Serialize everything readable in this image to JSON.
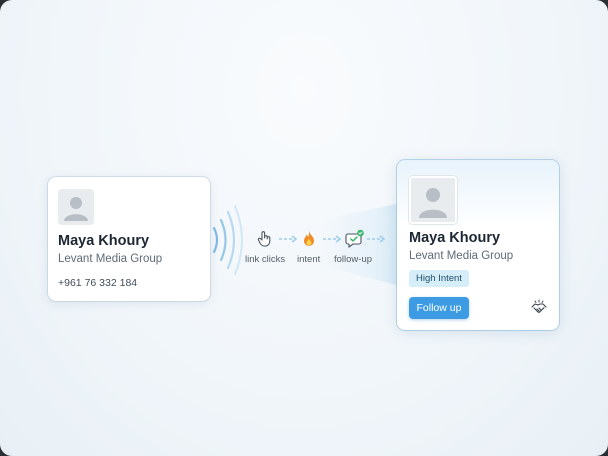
{
  "source_card": {
    "name": "Maya Khoury",
    "company": "Levant Media Group",
    "phone": "+961 76 332 184",
    "avatar_icon": "person-placeholder-icon",
    "signal_icon": "nfc-waves-icon"
  },
  "flow": {
    "steps": [
      {
        "label": "link clicks",
        "icon": "hand-pointer-icon"
      },
      {
        "label": "intent",
        "icon": "flame-icon"
      },
      {
        "label": "follow-up",
        "icon": "chat-check-icon"
      }
    ]
  },
  "crm_card": {
    "name": "Maya Khoury",
    "company": "Levant Media Group",
    "badge": "High Intent",
    "button": "Follow up",
    "avatar_icon": "person-placeholder-icon",
    "extra_icon": "handshake-icon"
  },
  "colors": {
    "accent": "#3d9be3",
    "badge_bg": "#d6eef8",
    "wave": "#7fb8e0",
    "flame": "#f08a24",
    "check": "#35b66a"
  }
}
